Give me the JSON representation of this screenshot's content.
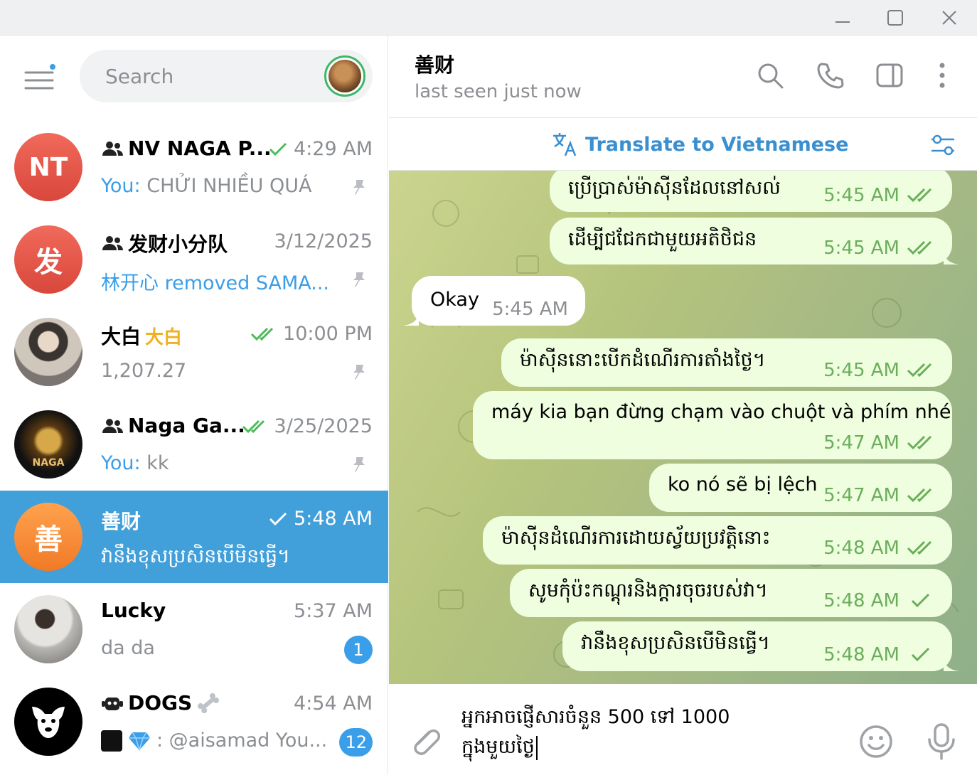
{
  "window": {
    "minimize_icon": "minimize-icon",
    "maximize_icon": "maximize-icon",
    "close_icon": "close-icon"
  },
  "sidebar": {
    "search": {
      "placeholder": "Search"
    },
    "chats": [
      {
        "name": "NV NAGA P...",
        "is_group": true,
        "time": "4:29 AM",
        "check": "single-green",
        "you_prefix": "You: ",
        "preview": "CHỬI NHIỀU QUÁ",
        "pinned": true,
        "avatar_text": "NT",
        "avatar_color": "#e35a4d"
      },
      {
        "name": "发财小分队",
        "is_group": true,
        "time": "3/12/2025",
        "check": "",
        "you_prefix": "",
        "preview": "林开心 removed SAMA...",
        "preview_color": "#3a9ee8",
        "pinned": true,
        "avatar_text": "发",
        "avatar_color": "#e35a4d"
      },
      {
        "name": "大白",
        "name_emoji": "大白",
        "is_group": false,
        "time": "10:00 PM",
        "check": "double-green",
        "you_prefix": "",
        "preview": "1,207.27",
        "pinned": true,
        "avatar_text": "",
        "avatar_color": "#888888"
      },
      {
        "name": "Naga Ga...",
        "is_group": true,
        "time": "3/25/2025",
        "check": "double-green",
        "you_prefix": "You: ",
        "preview": "kk",
        "pinned": true,
        "avatar_text": "NAGA",
        "avatar_color": "#1a1a1a"
      },
      {
        "name": "善财",
        "is_group": false,
        "time": "5:48 AM",
        "check": "single-white",
        "you_prefix": "",
        "preview": "វានឹងខុសប្រសិនបើមិនធ្វើ។",
        "pinned": false,
        "avatar_text": "善",
        "avatar_color": "#f5913c",
        "active": true
      },
      {
        "name": "Lucky",
        "is_group": false,
        "time": "5:37 AM",
        "check": "",
        "you_prefix": "",
        "preview": "da da",
        "badge": "1",
        "avatar_text": "",
        "avatar_color": "#d8d8d8"
      },
      {
        "name": "DOGS",
        "is_group": false,
        "time": "4:54 AM",
        "check": "",
        "you_prefix": "",
        "preview": ": @aisamad You...",
        "badge": "12",
        "avatar_text": "",
        "avatar_color": "#000000"
      }
    ]
  },
  "header": {
    "peer_name": "善财",
    "peer_status": "last seen just now"
  },
  "translate": {
    "label": "Translate to Vietnamese"
  },
  "messages": [
    {
      "dir": "out",
      "text": "ប្រើប្រាស់ម៉ាស៊ីនដែលនៅសល់",
      "time": "5:45 AM",
      "status": "read"
    },
    {
      "dir": "out",
      "text": "ដើម្បីជជែកជាមួយអតិថិជន",
      "time": "5:45 AM",
      "status": "read"
    },
    {
      "dir": "in",
      "text": "Okay",
      "time": "5:45 AM"
    },
    {
      "dir": "out",
      "text": "ម៉ាស៊ីននោះបើកដំណើរការតាំងថ្ងៃ។",
      "time": "5:45 AM",
      "status": "read"
    },
    {
      "dir": "out",
      "text": "máy kia bạn đừng chạm vào chuột và phím nhé",
      "time": "5:47 AM",
      "status": "read"
    },
    {
      "dir": "out",
      "text": "ko nó sẽ bị lệch",
      "time": "5:47 AM",
      "status": "read"
    },
    {
      "dir": "out",
      "text": "ម៉ាស៊ីនដំណើរការដោយស្វ័យប្រវត្តិនោះ",
      "time": "5:48 AM",
      "status": "read"
    },
    {
      "dir": "out",
      "text": "សូមកុំប៉ះកណ្ដុរនិងក្ដារចុចរបស់វា។",
      "time": "5:48 AM",
      "status": "sent"
    },
    {
      "dir": "out",
      "text": "វានឹងខុសប្រសិនបើមិនធ្វើ។",
      "time": "5:48 AM",
      "status": "sent"
    }
  ],
  "composer": {
    "line1": "អ្នកអាចផ្ញើសារចំនួន 500 ទៅ 1000",
    "line2": "ក្នុងមួយថ្ងៃ"
  },
  "colors": {
    "accent": "#419fd9",
    "outgoing_bubble": "#eefedf",
    "read_check": "#6aae5a"
  }
}
